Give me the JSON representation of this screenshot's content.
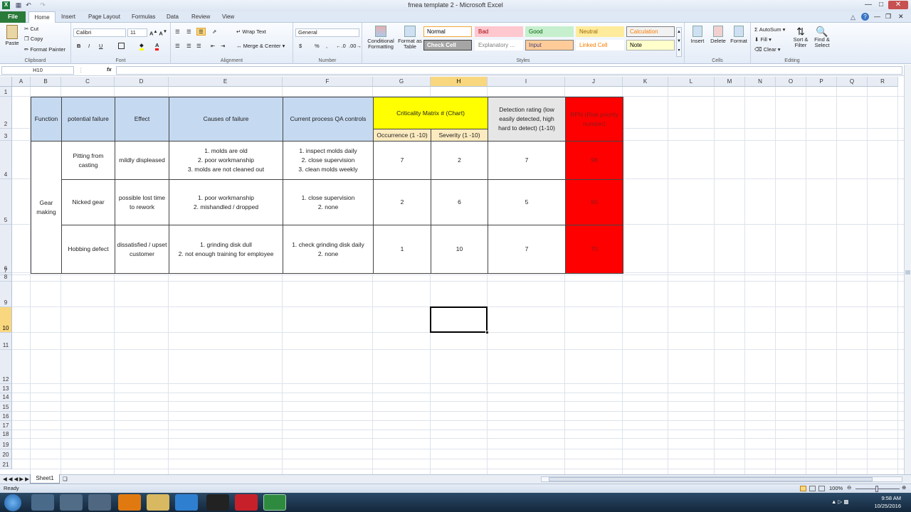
{
  "window": {
    "title": "fmea template 2 - Microsoft Excel"
  },
  "quick_access": [
    "save-icon",
    "undo-icon",
    "redo-icon"
  ],
  "tabs": [
    {
      "label": "File"
    },
    {
      "label": "Home"
    },
    {
      "label": "Insert"
    },
    {
      "label": "Page Layout"
    },
    {
      "label": "Formulas"
    },
    {
      "label": "Data"
    },
    {
      "label": "Review"
    },
    {
      "label": "View"
    }
  ],
  "ribbon": {
    "clipboard": {
      "paste": "Paste",
      "cut": "Cut",
      "copy": "Copy",
      "format_painter": "Format Painter",
      "name": "Clipboard"
    },
    "font": {
      "family": "Calibri",
      "size": "11",
      "bold": "B",
      "italic": "I",
      "underline": "U",
      "name": "Font"
    },
    "alignment": {
      "wrap": "Wrap Text",
      "merge": "Merge & Center",
      "name": "Alignment"
    },
    "number": {
      "format": "General",
      "currency": "$",
      "percent": "%",
      "comma": ",",
      "name": "Number"
    },
    "styles": {
      "conditional": "Conditional Formatting",
      "format_table": "Format as Table",
      "cell_styles": [
        {
          "label": "Normal",
          "bg": "#ffffff",
          "fg": "#000000",
          "border": "#f0a83a"
        },
        {
          "label": "Bad",
          "bg": "#ffc7ce",
          "fg": "#9c0006",
          "border": "#ffc7ce"
        },
        {
          "label": "Good",
          "bg": "#c6efce",
          "fg": "#006100",
          "border": "#c6efce"
        },
        {
          "label": "Neutral",
          "bg": "#ffeb9c",
          "fg": "#9c6500",
          "border": "#ffeb9c"
        },
        {
          "label": "Calculation",
          "bg": "#f2f2f2",
          "fg": "#fa7d00",
          "border": "#7f7f7f"
        },
        {
          "label": "Check Cell",
          "bg": "#a5a5a5",
          "fg": "#ffffff",
          "border": "#3f3f3f"
        },
        {
          "label": "Explanatory ...",
          "bg": "#ffffff",
          "fg": "#7f7f7f",
          "border": "#ffffff"
        },
        {
          "label": "Input",
          "bg": "#ffcc99",
          "fg": "#3f3f76",
          "border": "#7f7f7f"
        },
        {
          "label": "Linked Cell",
          "bg": "#ffffff",
          "fg": "#fa7d00",
          "border": "#ffffff"
        },
        {
          "label": "Note",
          "bg": "#ffffcc",
          "fg": "#000000",
          "border": "#b2b2b2"
        }
      ],
      "name": "Styles"
    },
    "cells": {
      "insert": "Insert",
      "delete": "Delete",
      "format": "Format",
      "name": "Cells"
    },
    "editing": {
      "autosum": "AutoSum",
      "fill": "Fill",
      "clear": "Clear",
      "sort": "Sort & Filter",
      "find": "Find & Select",
      "name": "Editing"
    }
  },
  "formula_bar": {
    "name_box": "H10",
    "fx": "fx",
    "value": ""
  },
  "columns": [
    "A",
    "B",
    "C",
    "D",
    "E",
    "F",
    "G",
    "H",
    "I",
    "J",
    "K",
    "L",
    "M",
    "N",
    "O",
    "P",
    "Q",
    "R"
  ],
  "rows": [
    "1",
    "2",
    "3",
    "4",
    "5",
    "6",
    "7",
    "8",
    "9",
    "10",
    "11",
    "12",
    "13",
    "14",
    "15",
    "16",
    "17",
    "18",
    "19",
    "20",
    "21"
  ],
  "selected_cell": {
    "column": "H",
    "row": "10"
  },
  "fmea_table": {
    "headers": {
      "function": "Function",
      "potential_failure": "potential failure",
      "effect": "Effect",
      "causes": "Causes of failure",
      "controls": "Current process QA controls",
      "criticality": "Criticality Matrix # (Chart)",
      "occurrence": "Occurrence (1 -10)",
      "severity": "Severity (1 -10)",
      "detection": "Detection rating (low easily detected, high hard to detect) (1-10)",
      "rpn": "RPN (Risk priority number)"
    },
    "function_value": "Gear making",
    "rows": [
      {
        "failure": "Pitting from casting",
        "effect": "mildly displeased",
        "causes": "1. molds are old\n2. poor workmanship\n3. molds are not cleaned out",
        "controls": "1. inspect molds daily\n2. close supervision\n3. clean molds weekly",
        "occurrence": "7",
        "severity": "2",
        "detection": "7",
        "rpn": "98"
      },
      {
        "failure": "Nicked gear",
        "effect": "possible lost time to rework",
        "causes": "1. poor workmanship\n2. mishandled / dropped",
        "controls": "1. close supervision\n2. none",
        "occurrence": "2",
        "severity": "6",
        "detection": "5",
        "rpn": "60"
      },
      {
        "failure": "Hobbing defect",
        "effect": "dissatisfied / upset customer",
        "causes": "1. grinding disk dull\n2. not enough training for employee",
        "controls": "1. check grinding disk daily\n2. none",
        "occurrence": "1",
        "severity": "10",
        "detection": "7",
        "rpn": "70"
      }
    ]
  },
  "colors": {
    "header_blue": "#c5d9f1",
    "criticality_yellow": "#ffff00",
    "subheader_tan": "#fcebc0",
    "detection_gray": "#e6e6e6",
    "rpn_red": "#ff0000",
    "rpn_text": "#8b1a1a"
  },
  "sheet_tabs": [
    {
      "label": "Sheet1"
    }
  ],
  "status": {
    "ready": "Ready",
    "zoom": "100%"
  },
  "taskbar": {
    "time": "9:58 AM",
    "date": "10/25/2016"
  }
}
